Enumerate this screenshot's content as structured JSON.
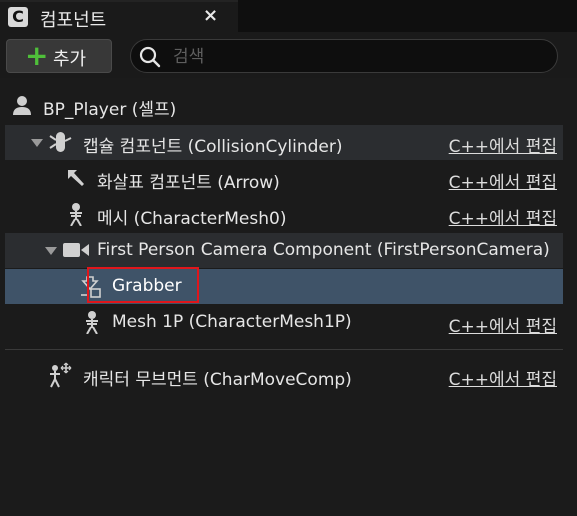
{
  "tab": {
    "title": "컴포넌트",
    "close": "×",
    "icon_letter": "C"
  },
  "toolbar": {
    "add_label": "추가",
    "add_icon": "plus-icon"
  },
  "search": {
    "placeholder": "검색",
    "value": ""
  },
  "tree": {
    "root": {
      "label": "BP_Player (셀프)",
      "icon": "person-icon"
    },
    "items": [
      {
        "label": "캡슐 컴포넌트 (CollisionCylinder)",
        "edit": "C++에서 편집",
        "icon": "capsule-icon",
        "expanded": true
      },
      {
        "label": "화살표 컴포넌트 (Arrow)",
        "edit": "C++에서 편집",
        "icon": "arrow-icon"
      },
      {
        "label": "메시 (CharacterMesh0)",
        "edit": "C++에서 편집",
        "icon": "skeleton-icon"
      },
      {
        "label": "First Person Camera Component (FirstPersonCamera)",
        "edit": "",
        "icon": "camera-icon",
        "expanded": true
      },
      {
        "label": "Grabber",
        "edit": "",
        "icon": "scene-component-icon",
        "selected": true
      },
      {
        "label": "Mesh 1P (CharacterMesh1P)",
        "edit": "C++에서 편집",
        "icon": "skeleton-icon"
      },
      {
        "label": "캐릭터 무브먼트 (CharMoveComp)",
        "edit": "C++에서 편집",
        "icon": "movement-icon"
      }
    ]
  },
  "colors": {
    "selection": "#3f5368",
    "highlight_box": "#e0161b",
    "add_plus": "#4fbf3a"
  }
}
